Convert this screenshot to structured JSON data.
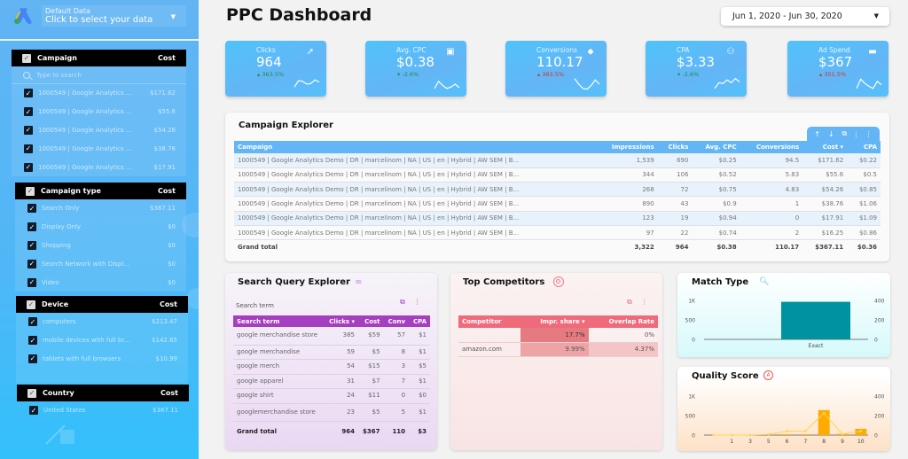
{
  "datasource": {
    "title": "Default Data",
    "subtitle": "Click to select your data",
    "icon": "google-ads-logo"
  },
  "filters": {
    "campaign": {
      "header": "Campaign",
      "value_header": "Cost",
      "search_placeholder": "Type to search",
      "items": [
        {
          "label": "1000549 | Google Analytics ...",
          "value": "$171.62"
        },
        {
          "label": "1000549 | Google Analytics ...",
          "value": "$55.6"
        },
        {
          "label": "1000549 | Google Analytics ...",
          "value": "$54.26"
        },
        {
          "label": "1000549 | Google Analytics ...",
          "value": "$38.76"
        },
        {
          "label": "1000549 | Google Analytics ...",
          "value": "$17.91"
        }
      ]
    },
    "campaign_type": {
      "header": "Campaign type",
      "value_header": "Cost",
      "items": [
        {
          "label": "Search Only",
          "value": "$367.11"
        },
        {
          "label": "Display Only",
          "value": "$0"
        },
        {
          "label": "Shopping",
          "value": "$0"
        },
        {
          "label": "Search Network with Displ...",
          "value": "$0"
        },
        {
          "label": "Video",
          "value": "$0"
        }
      ]
    },
    "device": {
      "header": "Device",
      "value_header": "Cost",
      "items": [
        {
          "label": "computers",
          "value": "$213.47"
        },
        {
          "label": "mobile devices with full br...",
          "value": "$142.65"
        },
        {
          "label": "tablets with full browsers",
          "value": "$10.99"
        }
      ]
    },
    "country": {
      "header": "Country",
      "value_header": "Cost",
      "items": [
        {
          "label": "United States",
          "value": "$367.11"
        }
      ]
    }
  },
  "header": {
    "title": "PPC Dashboard",
    "date_range": "Jun 1, 2020 - Jun 30, 2020"
  },
  "kpis": [
    {
      "label": "Clicks",
      "value": "964",
      "delta": "363.5%",
      "direction": "up",
      "status": "good",
      "icon": "cursor-click-icon",
      "spark": [
        0.3,
        0.75,
        0.7,
        0.5,
        0.55,
        0.8,
        0.65
      ]
    },
    {
      "label": "Avg. CPC",
      "value": "$0.38",
      "delta": "-2.6%",
      "direction": "down",
      "status": "good",
      "icon": "money-icon",
      "spark": [
        0.2,
        0.7,
        0.4,
        0.2,
        0.3,
        0.5,
        0.25
      ]
    },
    {
      "label": "Conversions",
      "value": "110.17",
      "delta": "363.5%",
      "direction": "up",
      "status": "bad",
      "icon": "tag-icon",
      "spark": [
        0.9,
        0.5,
        0.2,
        0.15,
        0.4,
        0.8,
        0.5
      ]
    },
    {
      "label": "CPA",
      "value": "$3.33",
      "delta": "-2.6%",
      "direction": "down",
      "status": "good",
      "icon": "user-cost-icon",
      "spark": [
        0.2,
        0.6,
        0.55,
        0.8,
        0.6,
        0.9,
        0.65
      ]
    },
    {
      "label": "Ad Spend",
      "value": "$367",
      "delta": "351.5%",
      "direction": "up",
      "status": "bad",
      "icon": "credit-card-icon",
      "spark": [
        0.2,
        0.85,
        0.55,
        0.35,
        0.2,
        0.7,
        0.45
      ]
    }
  ],
  "campaign_explorer": {
    "title": "Campaign Explorer",
    "columns": [
      "Campaign",
      "Impressions",
      "Clicks",
      "Avg. CPC",
      "Conversions",
      "Cost ▾",
      "CPA"
    ],
    "rows": [
      [
        "1000549 | Google Analytics Demo | DR | marcelinom | NA | US | en | Hybrid | AW SEM | B...",
        "1,539",
        "690",
        "$0.25",
        "94.5",
        "$171.62",
        "$0.22"
      ],
      [
        "1000549 | Google Analytics Demo | DR | marcelinom | NA | US | en | Hybrid | AW SEM | B...",
        "344",
        "106",
        "$0.52",
        "5.83",
        "$55.6",
        "$0.5"
      ],
      [
        "1000549 | Google Analytics Demo | DR | marcelinom | NA | US | en | Hybrid | AW SEM | B...",
        "268",
        "72",
        "$0.75",
        "4.83",
        "$54.26",
        "$0.85"
      ],
      [
        "1000549 | Google Analytics Demo | DR | marcelinom | NA | US | en | Hybrid | AW SEM | B...",
        "890",
        "43",
        "$0.9",
        "1",
        "$38.76",
        "$1.06"
      ],
      [
        "1000549 | Google Analytics Demo | DR | marcelinom | NA | US | en | Hybrid | AW SEM | B...",
        "123",
        "19",
        "$0.94",
        "0",
        "$17.91",
        "$1.09"
      ],
      [
        "1000549 | Google Analytics Demo | DR | marcelinom | NA | US | en | Hybrid | AW SEM | B...",
        "97",
        "22",
        "$0.74",
        "2",
        "$16.25",
        "$0.86"
      ]
    ],
    "total": [
      "Grand total",
      "3,322",
      "964",
      "$0.38",
      "110.17",
      "$367.11",
      "$0.36"
    ]
  },
  "search_query": {
    "title": "Search Query Explorer",
    "filter_label": "Search term",
    "columns": [
      "Search term",
      "Clicks ▾",
      "Cost",
      "Conv",
      "CPA"
    ],
    "rows": [
      [
        "google merchandise store",
        "385",
        "$59",
        "57",
        "$1"
      ],
      [
        "google merchandise",
        "59",
        "$5",
        "8",
        "$1"
      ],
      [
        "google merch",
        "54",
        "$15",
        "3",
        "$5"
      ],
      [
        "google apparel",
        "31",
        "$7",
        "7",
        "$1"
      ],
      [
        "google shirt",
        "24",
        "$11",
        "0",
        "$0"
      ],
      [
        "googlemerchandise store",
        "23",
        "$5",
        "5",
        "$1"
      ]
    ],
    "total": [
      "Grand total",
      "964",
      "$367",
      "110",
      "$3"
    ]
  },
  "competitors": {
    "title": "Top Competitors",
    "columns": [
      "Competitor",
      "Impr. share ▾",
      "Overlap Rate"
    ],
    "rows": [
      [
        "",
        "17.7%",
        "0%"
      ],
      [
        "amazon.com",
        "9.99%",
        "4.37%"
      ]
    ]
  },
  "chart_data": [
    {
      "type": "bar",
      "title": "Match Type",
      "categories": [
        "Exact"
      ],
      "series": [
        {
          "name": "Clicks",
          "axis": "left",
          "values": [
            964
          ]
        },
        {
          "name": "Conversions",
          "axis": "right",
          "values": [
            380
          ]
        }
      ],
      "ylim_left": [
        0,
        1000
      ],
      "ylim_right": [
        0,
        400
      ],
      "yticks_left": [
        "0",
        "500",
        "1K"
      ],
      "yticks_right": [
        "0",
        "200",
        "400"
      ],
      "color": "#00939f"
    },
    {
      "type": "bar",
      "title": "Quality Score",
      "categories": [
        "",
        "1",
        "3",
        "5",
        "6",
        "7",
        "8",
        "9",
        "10"
      ],
      "series": [
        {
          "name": "Clicks",
          "axis": "left",
          "type": "bar",
          "values": [
            0,
            0,
            0,
            5,
            20,
            20,
            640,
            30,
            160
          ]
        },
        {
          "name": "Conversions",
          "axis": "right",
          "type": "line",
          "values": [
            0,
            0,
            0,
            8,
            40,
            42,
            225,
            10,
            40
          ]
        }
      ],
      "ylim_left": [
        0,
        1000
      ],
      "ylim_right": [
        0,
        400
      ],
      "yticks_left": [
        "0",
        "500",
        "1K"
      ],
      "yticks_right": [
        "0",
        "200",
        "400"
      ],
      "bar_color": "#ffab00",
      "line_color": "#ffd54f"
    }
  ]
}
